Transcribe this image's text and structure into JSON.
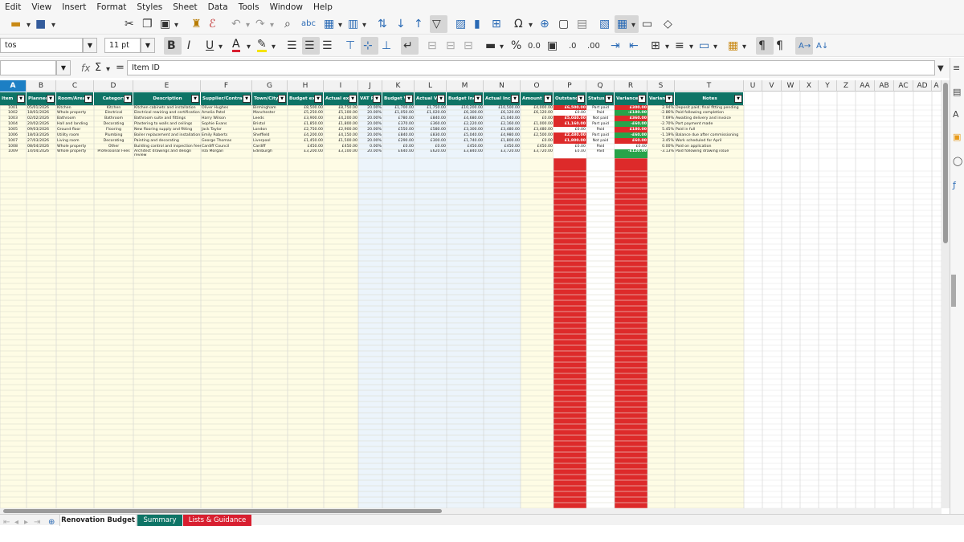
{
  "menu": [
    "Edit",
    "View",
    "Insert",
    "Format",
    "Styles",
    "Sheet",
    "Data",
    "Tools",
    "Window",
    "Help"
  ],
  "font_name": "tos",
  "font_size": "11 pt",
  "name_box": "",
  "formula": {
    "fx_label": "fx",
    "sigma_label": "Σ",
    "equals_label": "=",
    "content": "Item ID"
  },
  "columns": [
    "A",
    "B",
    "C",
    "D",
    "E",
    "F",
    "G",
    "H",
    "I",
    "J",
    "K",
    "L",
    "M",
    "N",
    "O",
    "P",
    "Q",
    "R",
    "S",
    "T",
    "U",
    "V",
    "W",
    "X",
    "Y",
    "Z",
    "AA",
    "AB",
    "AC",
    "AD",
    "A"
  ],
  "table_headers": [
    "Item",
    "Planned",
    "Room/Area",
    "Category",
    "Description",
    "Supplier/Contrac",
    "Town/City",
    "Budget ex",
    "Actual ex",
    "VAT R",
    "Budget V",
    "Actual V",
    "Budget Inc",
    "Actual Inc",
    "Amount",
    "Outstand",
    "Status",
    "Variance",
    "Varian",
    "Notes"
  ],
  "rows": [
    [
      "1001",
      "05/01/2026",
      "Kitchen",
      "Kitchen",
      "Kitchen cabinets and installation",
      "Oliver Hughes",
      "Birmingham",
      "£8,500.00",
      "£8,750.00",
      "20.00%",
      "£1,700.00",
      "£1,750.00",
      "£10,200.00",
      "£10,500.00",
      "£4,000.00",
      "£6,500.00",
      "Part paid",
      "£300.00",
      "2.94%",
      "Deposit paid; final fitting pending"
    ],
    [
      "1002",
      "18/01/2026",
      "Whole property",
      "Electrical",
      "Electrical rewiring and certification",
      "Amelia Patel",
      "Manchester",
      "£5,250.00",
      "£5,100.00",
      "20.00%",
      "£1,050.00",
      "£1,020.00",
      "£6,300.00",
      "£6,120.00",
      "£6,120.00",
      "£0.00",
      "Paid",
      "-£180.00",
      "-2.86%",
      "Paid following completion"
    ],
    [
      "1003",
      "02/02/2026",
      "Bathroom",
      "Bathroom",
      "Bathroom suite and fittings",
      "Harry Wilson",
      "Leeds",
      "£3,900.00",
      "£4,200.00",
      "20.00%",
      "£780.00",
      "£840.00",
      "£4,680.00",
      "£5,040.00",
      "£0.00",
      "£5,040.00",
      "Not paid",
      "£360.00",
      "7.69%",
      "Awaiting delivery and invoice"
    ],
    [
      "1004",
      "20/02/2026",
      "Hall and landing",
      "Decorating",
      "Plastering to walls and ceilings",
      "Sophie Evans",
      "Bristol",
      "£1,850.00",
      "£1,800.00",
      "20.00%",
      "£370.00",
      "£360.00",
      "£2,220.00",
      "£2,160.00",
      "£1,000.00",
      "£1,160.00",
      "Part paid",
      "-£60.00",
      "-2.70%",
      "Part payment made"
    ],
    [
      "1005",
      "09/03/2026",
      "Ground floor",
      "Flooring",
      "New flooring supply and fitting",
      "Jack Taylor",
      "London",
      "£2,750.00",
      "£2,900.00",
      "20.00%",
      "£550.00",
      "£580.00",
      "£3,300.00",
      "£3,480.00",
      "£3,480.00",
      "£0.00",
      "Paid",
      "£180.00",
      "5.45%",
      "Paid in full"
    ],
    [
      "1006",
      "18/03/2026",
      "Utility room",
      "Plumbing",
      "Boiler replacement and installation",
      "Emily Roberts",
      "Sheffield",
      "£4,200.00",
      "£4,150.00",
      "20.00%",
      "£840.00",
      "£830.00",
      "£5,040.00",
      "£4,980.00",
      "£2,500.00",
      "£2,480.00",
      "Part paid",
      "-£60.00",
      "-1.19%",
      "Balance due after commissioning"
    ],
    [
      "1007",
      "27/03/2026",
      "Living room",
      "Decorating",
      "Painting and decorating",
      "George Thomas",
      "Liverpool",
      "£1,450.00",
      "£1,500.00",
      "20.00%",
      "£290.00",
      "£300.00",
      "£1,740.00",
      "£1,800.00",
      "£0.00",
      "£1,800.00",
      "Not paid",
      "£60.00",
      "3.45%",
      "Work scheduled for April"
    ],
    [
      "1008",
      "08/04/2026",
      "Whole property",
      "Other",
      "Building control and inspection fees",
      "Cardiff Council",
      "Cardiff",
      "£450.00",
      "£450.00",
      "0.00%",
      "£0.00",
      "£0.00",
      "£450.00",
      "£450.00",
      "£450.00",
      "£0.00",
      "Paid",
      "£0.00",
      "0.00%",
      "Paid on application"
    ],
    [
      "1009",
      "14/04/2026",
      "Whole property",
      "Professional Fees",
      "Architect drawings and design review",
      "Isla Morgan",
      "Edinburgh",
      "£3,200.00",
      "£3,100.00",
      "20.00%",
      "£640.00",
      "£620.00",
      "£3,840.00",
      "£3,720.00",
      "£3,720.00",
      "£0.00",
      "Paid",
      "-£120.00",
      "-3.13%",
      "Paid following drawing issue"
    ]
  ],
  "sheet_tabs": [
    "Renovation Budget",
    "Summary",
    "Lists & Guidance"
  ],
  "colors": {
    "header_teal": "#0e7466",
    "highlight_red": "#dd2a2a",
    "highlight_green": "#27a34a",
    "summary_tab": "#0e7466",
    "lists_tab": "#d81f30",
    "light_yellow": "#fefce5",
    "light_blue": "#ecf4fb",
    "selection_blue": "#1c7fc4"
  },
  "icons": [
    "open-icon",
    "save-icon",
    "cut-icon",
    "copy-icon",
    "paste-icon",
    "clone-formatting-icon",
    "clear-formatting-icon",
    "undo-icon",
    "redo-icon",
    "find-replace-icon",
    "spelling-icon",
    "row-icon",
    "column-icon",
    "sort-icon",
    "sort-ascending-icon",
    "sort-descending-icon",
    "autofilter-icon",
    "image-icon",
    "chart-icon",
    "pivot-table-icon",
    "special-character-icon",
    "hyperlink-icon",
    "comment-icon",
    "headers-footers-icon",
    "define-print-area-icon",
    "freeze-rows-columns-icon",
    "split-window-icon",
    "show-draw-functions-icon"
  ]
}
